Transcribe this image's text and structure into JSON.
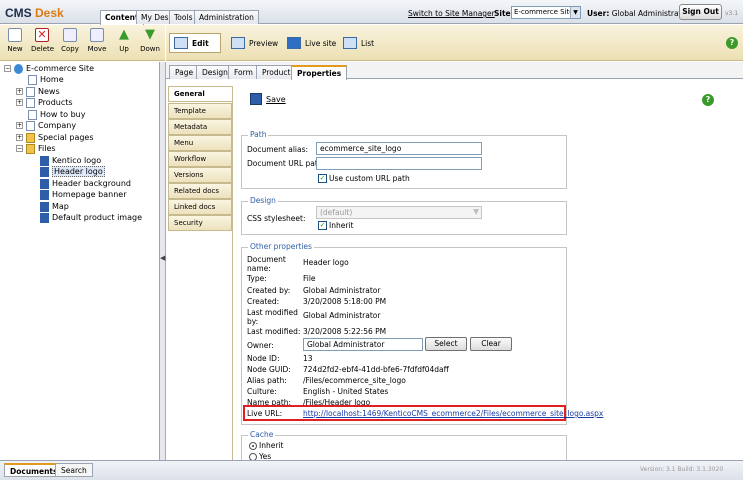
{
  "app": {
    "logo_cms": "CMS",
    "logo_desk": "Desk",
    "version_badge": "v3.1"
  },
  "top_tabs": [
    "Content",
    "My Desk",
    "Tools",
    "Administration"
  ],
  "header": {
    "switch_link": "Switch to Site Manager",
    "site_label": "Site:",
    "site_value": "E-commerce Site",
    "user_label": "User:",
    "user_value": "Global Administrator",
    "signout_label": "Sign Out"
  },
  "toolbar": {
    "buttons": [
      "New",
      "Delete",
      "Copy",
      "Move",
      "Up",
      "Down"
    ]
  },
  "view_toolbar": {
    "buttons": [
      "Edit",
      "Preview",
      "Live site",
      "List"
    ]
  },
  "tree": {
    "root": "E-commerce Site",
    "items": [
      {
        "label": "Home"
      },
      {
        "label": "News"
      },
      {
        "label": "Products"
      },
      {
        "label": "How to buy"
      },
      {
        "label": "Company"
      },
      {
        "label": "Special pages"
      },
      {
        "label": "Files"
      },
      {
        "label": "Kentico logo"
      },
      {
        "label": "Header logo"
      },
      {
        "label": "Header background"
      },
      {
        "label": "Homepage banner"
      },
      {
        "label": "Map"
      },
      {
        "label": "Default product image"
      }
    ]
  },
  "doc_tabs": [
    "Page",
    "Design",
    "Form",
    "Product",
    "Properties"
  ],
  "side_tabs": [
    "General",
    "Template",
    "Metadata",
    "Menu",
    "Workflow",
    "Versions",
    "Related docs",
    "Linked docs",
    "Security"
  ],
  "content": {
    "save_label": "Save",
    "path": {
      "legend": "Path",
      "alias_label": "Document alias:",
      "alias_value": "ecommerce_site_logo",
      "url_label": "Document URL path:",
      "url_value": "",
      "custom_label": "Use custom URL path"
    },
    "design": {
      "legend": "Design",
      "css_label": "CSS stylesheet:",
      "css_value": "(default)",
      "inherit_label": "Inherit"
    },
    "other": {
      "legend": "Other properties",
      "rows": [
        {
          "label": "Document name:",
          "value": "Header logo"
        },
        {
          "label": "Type:",
          "value": "File"
        },
        {
          "label": "Created by:",
          "value": "Global Administrator"
        },
        {
          "label": "Created:",
          "value": "3/20/2008 5:18:00 PM"
        },
        {
          "label": "Last modified by:",
          "value": "Global Administrator"
        },
        {
          "label": "Last modified:",
          "value": "3/20/2008 5:22:56 PM"
        }
      ],
      "owner_label": "Owner:",
      "owner_value": "Global Administrator",
      "select_label": "Select",
      "clear_label": "Clear",
      "rows2": [
        {
          "label": "Node ID:",
          "value": "13"
        },
        {
          "label": "Node GUID:",
          "value": "724d2fd2-ebf4-41dd-bfe6-7fdfdf04daff"
        },
        {
          "label": "Alias path:",
          "value": "/Files/ecommerce_site_logo"
        },
        {
          "label": "Culture:",
          "value": "English - United States"
        },
        {
          "label": "Name path:",
          "value": "/Files/Header logo"
        }
      ],
      "live_label": "Live URL:",
      "live_value": "http://localhost:1469/KenticoCMS_ecommerce2/Files/ecommerce_site_logo.aspx"
    },
    "cache": {
      "legend": "Cache",
      "opt_inherit": "Inherit",
      "opt_yes": "Yes"
    }
  },
  "bottom_tabs": [
    "Documents",
    "Search"
  ],
  "footer_version": "Version: 3.1 Build: 3.1.3020"
}
